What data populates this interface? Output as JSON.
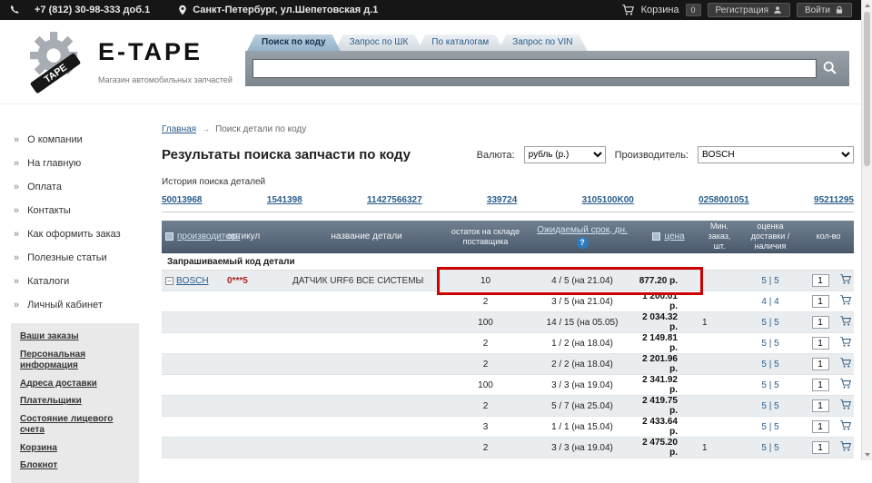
{
  "colors": {
    "accent_blue": "#2a5d8c",
    "table_header_top": "#71808f",
    "table_header_bottom": "#4b5b6e",
    "highlight_red": "#cc0000",
    "row_alt": "#eaedf0",
    "topbar_bg": "#161616"
  },
  "topbar": {
    "phone": "+7 (812) 30-98-333 доб.1",
    "address": "Санкт-Петербург, ул.Шепетовская д.1",
    "cart_label": "Корзина",
    "cart_count": "0",
    "register_label": "Регистрация",
    "login_label": "Войти"
  },
  "header": {
    "brand": "E-TAPE",
    "tagline": "Магазин автомобильных запчастей",
    "tabs": [
      {
        "label": "Поиск по коду",
        "active": true
      },
      {
        "label": "Запрос по ШК",
        "active": false
      },
      {
        "label": "По каталогам",
        "active": false
      },
      {
        "label": "Запрос по VIN",
        "active": false
      }
    ],
    "search": {
      "value": "",
      "placeholder": ""
    }
  },
  "sidebar": {
    "items": [
      "О компании",
      "На главную",
      "Оплата",
      "Контакты",
      "Как оформить заказ",
      "Полезные статьи",
      "Каталоги",
      "Личный кабинет"
    ],
    "account_links": [
      "Ваши заказы",
      "Персональная информация",
      "Адреса доставки",
      "Плательщики",
      "Состояние лицевого счета",
      "Корзина",
      "Блокнот"
    ]
  },
  "main": {
    "breadcrumb": {
      "home": "Главная",
      "current": "Поиск детали по коду"
    },
    "title": "Результаты поиска запчасти по коду",
    "currency": {
      "label": "Валюта:",
      "value": "рубль (р.)"
    },
    "manufacturer": {
      "label": "Производитель:",
      "value": "BOSCH"
    },
    "history": {
      "label": "История поиска деталей",
      "links": [
        "50013968",
        "1541398",
        "11427566327",
        "339724",
        "3105100K00",
        "0258001051",
        "95211295"
      ]
    },
    "table": {
      "headers": {
        "manufacturer": "производитель",
        "article": "артикул",
        "name": "название детали",
        "stock": "остаток на складе поставщика",
        "term": "Ожидаемый срок, дн.",
        "price": "цена",
        "min_order": "Мин. заказ, шт.",
        "delivery": "оценка доставки / наличия",
        "qty": "кол-во"
      },
      "section_label": "Запрашиваемый код детали",
      "rows": [
        {
          "manufacturer": "BOSCH",
          "article": "0***5",
          "name": "ДАТЧИК URF6 ВСЕ СИСТЕМЫ",
          "stock": "10",
          "term": "4 / 5 (на 21.04)",
          "price": "877.20 р.",
          "min_order": "",
          "delivery": "5 | 5",
          "qty": "1",
          "highlighted": true
        },
        {
          "manufacturer": "",
          "article": "",
          "name": "",
          "stock": "2",
          "term": "3 / 5 (на 21.04)",
          "price": "1 200.01 р.",
          "min_order": "",
          "delivery": "4 | 4",
          "qty": "1",
          "highlighted": false
        },
        {
          "manufacturer": "",
          "article": "",
          "name": "",
          "stock": "100",
          "term": "14 / 15 (на 05.05)",
          "price": "2 034.32 р.",
          "min_order": "1",
          "delivery": "5 | 5",
          "qty": "1",
          "highlighted": false
        },
        {
          "manufacturer": "",
          "article": "",
          "name": "",
          "stock": "2",
          "term": "1 / 2 (на 18.04)",
          "price": "2 149.81 р.",
          "min_order": "",
          "delivery": "5 | 5",
          "qty": "1",
          "highlighted": false
        },
        {
          "manufacturer": "",
          "article": "",
          "name": "",
          "stock": "2",
          "term": "2 / 2 (на 18.04)",
          "price": "2 201.96 р.",
          "min_order": "",
          "delivery": "5 | 5",
          "qty": "1",
          "highlighted": false
        },
        {
          "manufacturer": "",
          "article": "",
          "name": "",
          "stock": "100",
          "term": "3 / 3 (на 19.04)",
          "price": "2 341.92 р.",
          "min_order": "",
          "delivery": "5 | 5",
          "qty": "1",
          "highlighted": false
        },
        {
          "manufacturer": "",
          "article": "",
          "name": "",
          "stock": "2",
          "term": "5 / 7 (на 25.04)",
          "price": "2 419.75 р.",
          "min_order": "",
          "delivery": "5 | 5",
          "qty": "1",
          "highlighted": false
        },
        {
          "manufacturer": "",
          "article": "",
          "name": "",
          "stock": "3",
          "term": "1 / 1 (на 15.04)",
          "price": "2 433.64 р.",
          "min_order": "",
          "delivery": "5 | 5",
          "qty": "1",
          "highlighted": false
        },
        {
          "manufacturer": "",
          "article": "",
          "name": "",
          "stock": "2",
          "term": "3 / 3 (на 19.04)",
          "price": "2 475.20 р.",
          "min_order": "1",
          "delivery": "5 | 5",
          "qty": "1",
          "highlighted": false
        }
      ]
    }
  }
}
